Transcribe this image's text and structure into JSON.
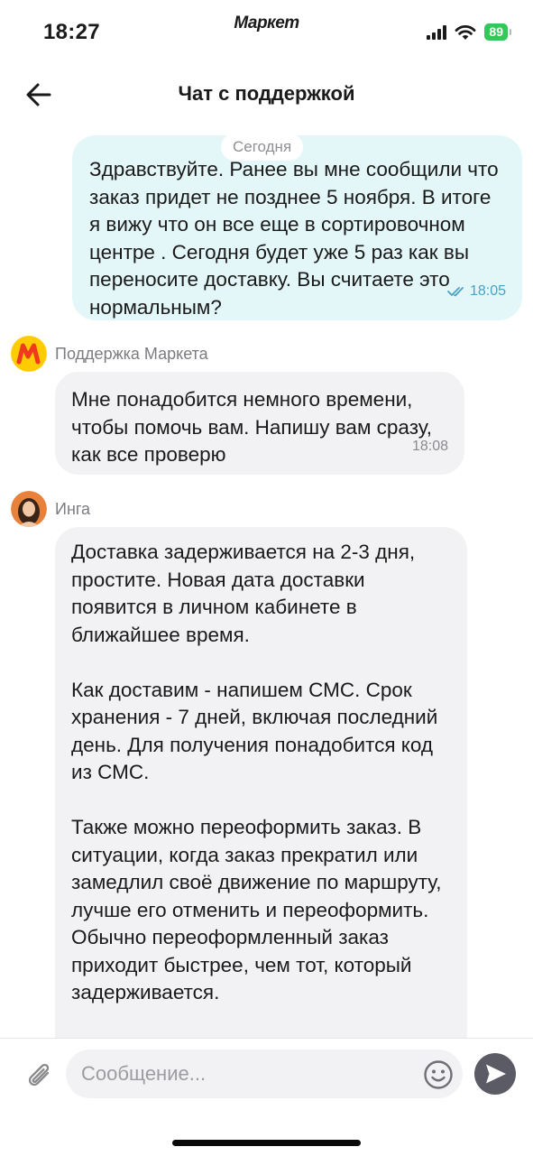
{
  "status_bar": {
    "time": "18:27",
    "app_name": "Маркет",
    "battery": "89",
    "battery_color": "#35c759",
    "icons": [
      "signal-icon",
      "wifi-icon",
      "battery-icon"
    ]
  },
  "header": {
    "title": "Чат с поддержкой",
    "back_icon": "arrow-left-icon"
  },
  "chat": {
    "date_label": "Сегодня",
    "messages": [
      {
        "direction": "outgoing",
        "text": "Здравствуйте. Ранее вы мне сообщили что заказ придет не позднее 5 ноября. В итоге я вижу что он все еще в сортировочном центре . Сегодня будет уже 5 раз как вы переносите доставку. Вы считаете это нормальным?",
        "time": "18:05",
        "status_icon": "double-check-icon",
        "bubble_color": "#e3f6f8"
      },
      {
        "direction": "incoming",
        "sender": "Поддержка Маркета",
        "avatar_icon": "market-logo-icon",
        "text": "Мне понадобится немного времени, чтобы помочь вам. Напишу вам сразу, как все проверю",
        "time": "18:08"
      },
      {
        "direction": "incoming",
        "sender": "Инга",
        "avatar_icon": "operator-avatar",
        "paragraphs": [
          "Доставка задерживается на 2-3 дня, простите. Новая дата доставки появится в личном кабинете в ближайшее время.",
          "Как доставим - напишем СМС. Срок хранения - 7 дней, включая последний день. Для получения понадобится код из СМС.",
          "Также можно переоформить заказ. В ситуации, когда заказ прекратил или замедлил своё движение по маршруту, лучше его отменить и переоформить. Обычно переоформленный заказ приходит быстрее, чем тот, который задерживается."
        ]
      }
    ]
  },
  "composer": {
    "placeholder": "Сообщение...",
    "attach_icon": "paperclip-icon",
    "emoji_icon": "smiley-icon",
    "send_icon": "send-icon"
  },
  "colors": {
    "incoming_bubble": "#f2f2f4",
    "brand_yellow": "#ffcc00",
    "brand_red": "#f0391f",
    "send_button": "#5b5b66"
  }
}
